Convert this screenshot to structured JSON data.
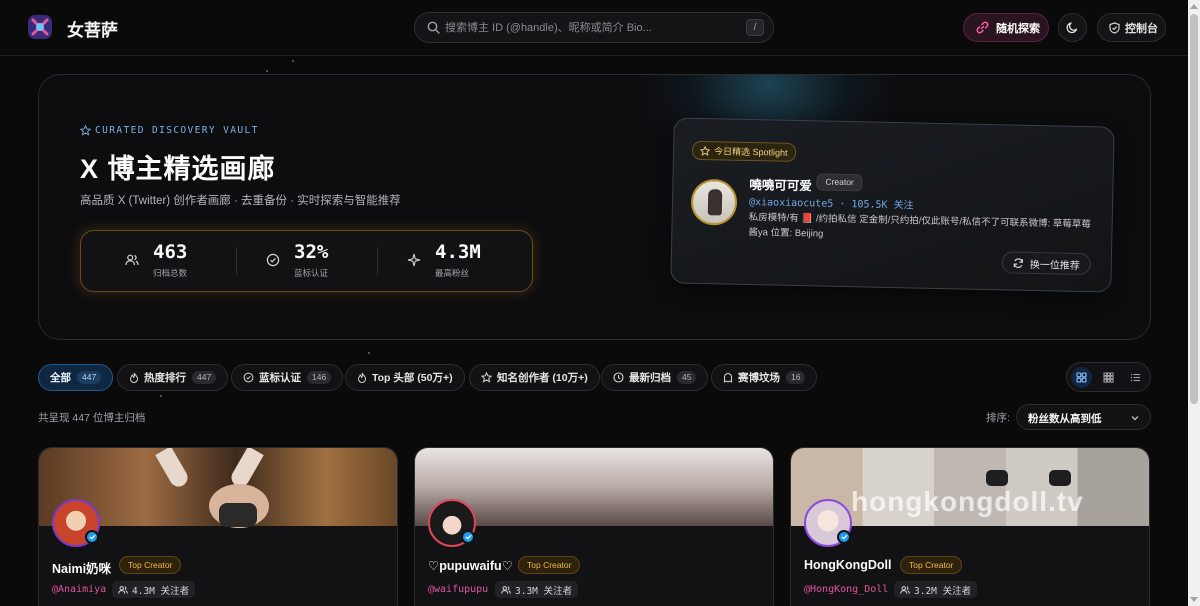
{
  "header": {
    "brand": "女菩萨",
    "search_placeholder": "搜索博主 ID (@handle)、昵称或简介 Bio...",
    "search_shortcut": "/",
    "random_label": "随机探索",
    "console_label": "控制台"
  },
  "hero": {
    "tagline": "CURATED DISCOVERY VAULT",
    "title": "X 博主精选画廊",
    "subtitle": "高品质 X (Twitter) 创作者画廊 · 去重备份 · 实时探索与智能推荐",
    "stats": [
      {
        "value": "463",
        "label": "归档总数",
        "icon": "users-icon"
      },
      {
        "value": "32%",
        "label": "蓝标认证",
        "icon": "check-circle-icon"
      },
      {
        "value": "4.3M",
        "label": "最高粉丝",
        "icon": "sparkle-icon"
      }
    ],
    "spotlight": {
      "badge": "今日精选 Spotlight",
      "name": "嘵嘵可可爱",
      "role": "Creator",
      "handle": "@xiaoxiaocute5",
      "followers": "105.5K 关注",
      "bio": "私房模特/有 📕 /约拍私信 定金制/只约拍/仅此账号/私信不了可联系微博: 草莓草莓酱ya 位置: Beijing",
      "shuffle_label": "换一位推荐"
    }
  },
  "filters": [
    {
      "label": "全部",
      "count": "447",
      "icon": "",
      "active": true
    },
    {
      "label": "热度排行",
      "count": "447",
      "icon": "flame-icon",
      "active": false
    },
    {
      "label": "蓝标认证",
      "count": "146",
      "icon": "check-circle-icon",
      "active": false
    },
    {
      "label": "Top 头部 (50万+)",
      "count": "",
      "icon": "flame-icon",
      "active": false
    },
    {
      "label": "知名创作者 (10万+)",
      "count": "",
      "icon": "star-icon",
      "active": false
    },
    {
      "label": "最新归档",
      "count": "45",
      "icon": "clock-icon",
      "active": false
    },
    {
      "label": "赛博坟场",
      "count": "16",
      "icon": "ghost-icon",
      "active": false
    }
  ],
  "results": {
    "count_text": "共呈现 447 位博主归档",
    "sort_label": "排序:",
    "sort_value": "粉丝数从高到低"
  },
  "cards": [
    {
      "name": "Naimi奶咪",
      "badge": "Top Creator",
      "handle": "@Anaimiya",
      "followers": "4.3M 关注者",
      "banner": "#6b4a2e"
    },
    {
      "name": "♡pupuwaifu♡",
      "badge": "Top Creator",
      "handle": "@waifupupu",
      "followers": "3.3M 关注者",
      "banner": "#9a8a86"
    },
    {
      "name": "HongKongDoll",
      "badge": "Top Creator",
      "handle": "@HongKong_Doll",
      "followers": "3.2M 关注者",
      "banner": "#bdb6ad",
      "watermark": "hongkongdoll.tv"
    }
  ]
}
